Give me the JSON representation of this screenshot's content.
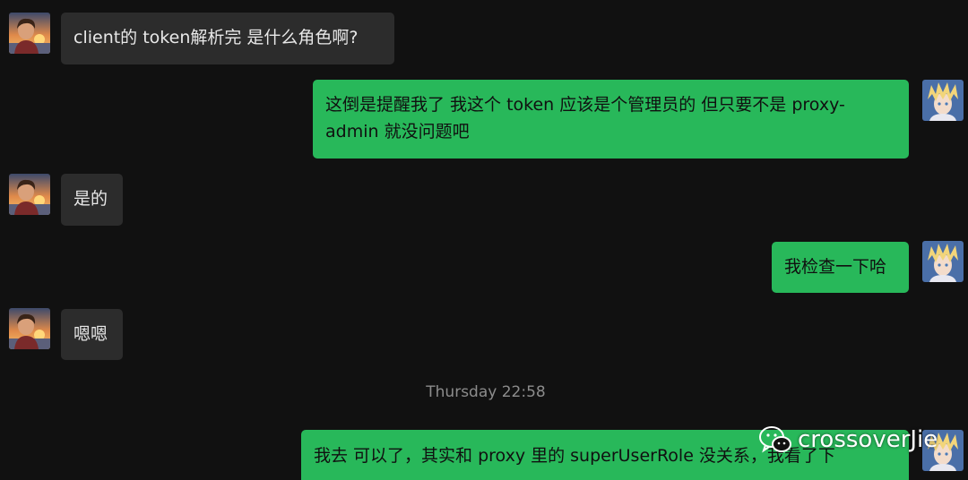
{
  "messages": [
    {
      "sender": "other",
      "text": "client的 token解析完 是什么角色啊?"
    },
    {
      "sender": "self",
      "text": "这倒是提醒我了   我这个 token 应该是个管理员的  但只要不是 proxy-admin 就没问题吧"
    },
    {
      "sender": "other",
      "text": "是的"
    },
    {
      "sender": "self",
      "text": "我检查一下哈"
    },
    {
      "sender": "other",
      "text": "嗯嗯"
    },
    {
      "sender": "self",
      "text": "我去 可以了，其实和 proxy 里的 superUserRole 没关系，我看了下"
    }
  ],
  "timestamp": "Thursday 22:58",
  "watermark": "crossoverJie",
  "colors": {
    "background": "#111111",
    "incoming_bubble": "#2c2c2c",
    "outgoing_bubble": "#28b85a",
    "timestamp_text": "#8c8c8c"
  },
  "icons": {
    "other_avatar": "sunset-portrait-avatar",
    "self_avatar": "anime-blond-avatar",
    "watermark_logo": "wechat-icon"
  }
}
